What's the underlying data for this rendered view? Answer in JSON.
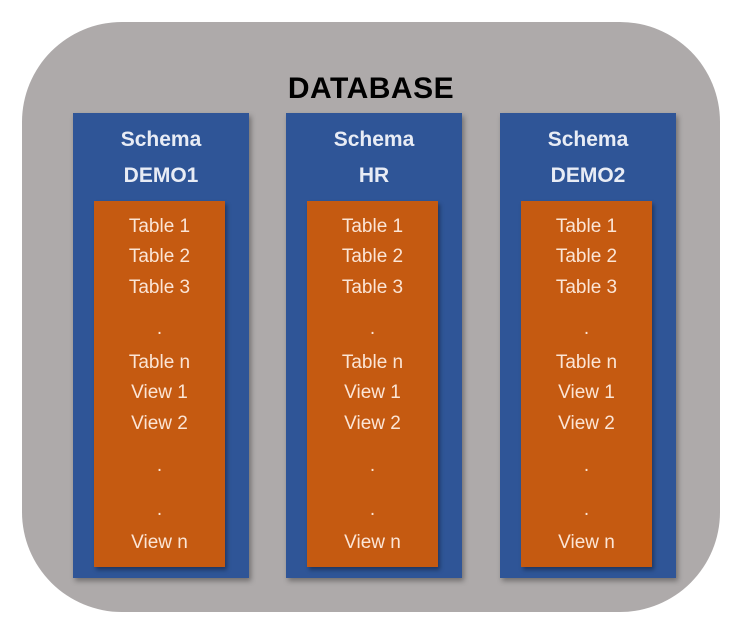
{
  "database": {
    "title": "DATABASE"
  },
  "schemas": [
    {
      "label": "Schema",
      "name": "DEMO1",
      "objects": [
        "Table 1",
        "Table 2",
        "Table 3",
        ".",
        "Table n",
        "View 1",
        "View 2",
        ".",
        ".",
        "View n"
      ]
    },
    {
      "label": "Schema",
      "name": "HR",
      "objects": [
        "Table 1",
        "Table 2",
        "Table 3",
        ".",
        "Table n",
        "View 1",
        "View 2",
        ".",
        ".",
        "View n"
      ]
    },
    {
      "label": "Schema",
      "name": "DEMO2",
      "objects": [
        "Table 1",
        "Table 2",
        "Table 3",
        ".",
        "Table n",
        "View 1",
        "View 2",
        ".",
        ".",
        "View n"
      ]
    }
  ],
  "colors": {
    "database": "#aeaaaa",
    "schema": "#2f5597",
    "objects": "#c55a11"
  }
}
